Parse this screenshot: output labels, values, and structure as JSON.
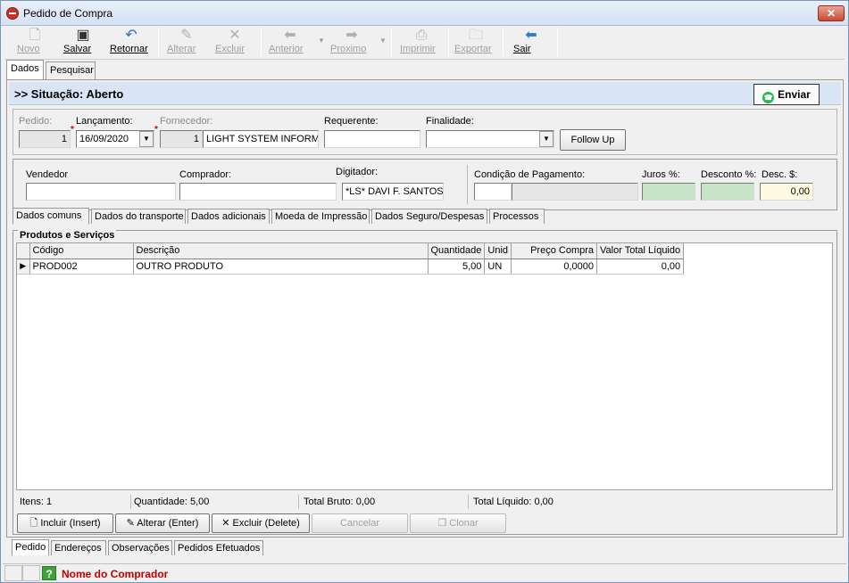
{
  "window": {
    "title": "Pedido de Compra",
    "close_label": "✕"
  },
  "toolbar": {
    "novo": "Novo",
    "salvar": "Salvar",
    "retornar": "Retornar",
    "alterar": "Alterar",
    "excluir": "Excluir",
    "anterior": "Anterior",
    "proximo": "Proximo",
    "imprimir": "Imprimir",
    "exportar": "Exportar",
    "sair": "Sair"
  },
  "top_tabs": {
    "dados": "Dados",
    "pesquisar": "Pesquisar"
  },
  "situacao": "&gt;&gt; Situação: Aberto",
  "enviar_label": "Enviar",
  "form": {
    "pedido_label": "Pedido:",
    "pedido_value": "1",
    "lancamento_label": "Lançamento:",
    "lancamento_value": "16/09/2020",
    "fornecedor_label": "Fornecedor:",
    "fornecedor_code": "1",
    "fornecedor_name": "LIGHT SYSTEM INFORMA",
    "requerente_label": "Requerente:",
    "requerente_value": "",
    "finalidade_label": "Finalidade:",
    "finalidade_value": "",
    "followup_label": "Follow Up",
    "vendedor_label": "Vendedor",
    "vendedor_value": "",
    "comprador_label": "Comprador:",
    "comprador_value": "",
    "digitador_label": "Digitador:",
    "digitador_value": "*LS* DAVI F. SANTOS",
    "condicao_label": "Condição de Pagamento:",
    "condicao_code": "",
    "condicao_desc": "",
    "juros_label": "Juros %:",
    "juros_value": "",
    "desconto_label": "Desconto %:",
    "desconto_value": "",
    "descs_label": "Desc. $:",
    "descs_value": "0,00"
  },
  "sub_tabs": [
    "Dados comuns",
    "Dados do transporte",
    "Dados adicionais",
    "Moeda de Impressão",
    "Dados Seguro/Despesas",
    "Processos"
  ],
  "products": {
    "group_label": "Produtos e Serviços",
    "columns": [
      "Código",
      "Descrição",
      "Quantidade",
      "Unid",
      "Preço Compra",
      "Valor Total Líquido"
    ],
    "rows": [
      {
        "codigo": "PROD002",
        "descricao": "OUTRO PRODUTO",
        "quantidade": "5,00",
        "unid": "UN",
        "preco": "0,0000",
        "total": "0,00"
      }
    ]
  },
  "summary": {
    "itens": "Itens: 1",
    "quantidade": "Quantidade: 5,00",
    "total_bruto": "Total Bruto: 0,00",
    "total_liquido": "Total Líquido: 0,00"
  },
  "actions": {
    "incluir": "Incluir (Insert)",
    "alterar": "Alterar (Enter)",
    "excluir": "Excluir (Delete)",
    "cancelar": "Cancelar",
    "clonar": "Clonar"
  },
  "bottom_tabs": [
    "Pedido",
    "Endereços",
    "Observações",
    "Pedidos Efetuados"
  ],
  "status": {
    "nome_comprador": "Nome do Comprador"
  }
}
